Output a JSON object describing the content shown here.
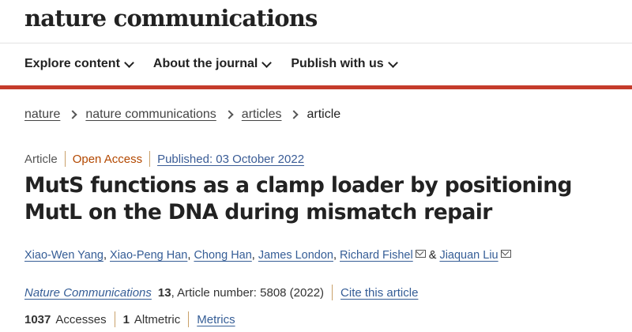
{
  "site": {
    "logo": "nature communications"
  },
  "nav": [
    {
      "label": "Explore content"
    },
    {
      "label": "About the journal"
    },
    {
      "label": "Publish with us"
    }
  ],
  "breadcrumb": {
    "items": [
      "nature",
      "nature communications",
      "articles"
    ],
    "current": "article"
  },
  "article": {
    "type": "Article",
    "access": "Open Access",
    "published": "Published: 03 October 2022",
    "title": "MutS functions as a clamp loader by positioning MutL on the DNA during mismatch repair",
    "authors": [
      "Xiao-Wen Yang",
      "Xiao-Peng Han",
      "Chong Han",
      "James London",
      "Richard Fishel",
      "Jiaquan Liu"
    ],
    "author_sep": ", ",
    "author_and": " & ",
    "journal": "Nature Communications",
    "volume": "13",
    "article_number": ", Article number: 5808 (2022)",
    "cite_label": "Cite this article",
    "accesses_count": "1037",
    "accesses_label": "Accesses",
    "altmetric_count": "1",
    "altmetric_label": "Altmetric",
    "metrics_label": "Metrics"
  },
  "colors": {
    "accent_red": "#c53b2b",
    "link_blue": "#355d96",
    "open_access_orange": "#b34800"
  }
}
